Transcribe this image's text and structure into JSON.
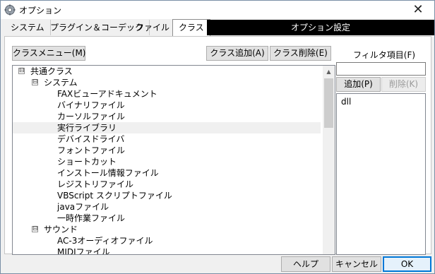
{
  "window": {
    "title": "オプション",
    "close_glyph": "✕"
  },
  "tabs": [
    {
      "label": "システム"
    },
    {
      "label": "プラグイン＆コーデック"
    },
    {
      "label": "ファイル"
    },
    {
      "label": "クラス"
    }
  ],
  "tab_header": "オプション設定",
  "toolbar": {
    "class_menu": "クラスメニュー(M)",
    "add_class": "クラス追加(A)",
    "delete_class": "クラス削除(E)"
  },
  "tree": {
    "items": [
      {
        "label": "共通クラス",
        "expander": "⊟"
      },
      {
        "label": "システム",
        "expander": "⊟"
      },
      {
        "label": "FAXビューアドキュメント"
      },
      {
        "label": "バイナリファイル"
      },
      {
        "label": "カーソルファイル"
      },
      {
        "label": "実行ライブラリ",
        "selected": true
      },
      {
        "label": "デバイスドライバ"
      },
      {
        "label": "フォントファイル"
      },
      {
        "label": "ショートカット"
      },
      {
        "label": "インストール情報ファイル"
      },
      {
        "label": "レジストリファイル"
      },
      {
        "label": "VBScript スクリプトファイル"
      },
      {
        "label": "javaファイル"
      },
      {
        "label": "一時作業ファイル"
      },
      {
        "label": "サウンド",
        "expander": "⊟"
      },
      {
        "label": "AC-3オーディオファイル"
      },
      {
        "label": "MIDIファイル"
      }
    ],
    "scroll_up": "▲"
  },
  "filter": {
    "label": "フィルタ項目(F)",
    "value": "",
    "add_button": "追加(P)",
    "delete_button": "削除(K)",
    "items": [
      "dll"
    ]
  },
  "footer": {
    "help": "ヘルプ",
    "cancel": "キャンセル",
    "ok": "OK"
  },
  "colors": {
    "tab_header_bg": "#000000",
    "selection": "#f0f0f0",
    "default_button_border": "#0078d7"
  }
}
